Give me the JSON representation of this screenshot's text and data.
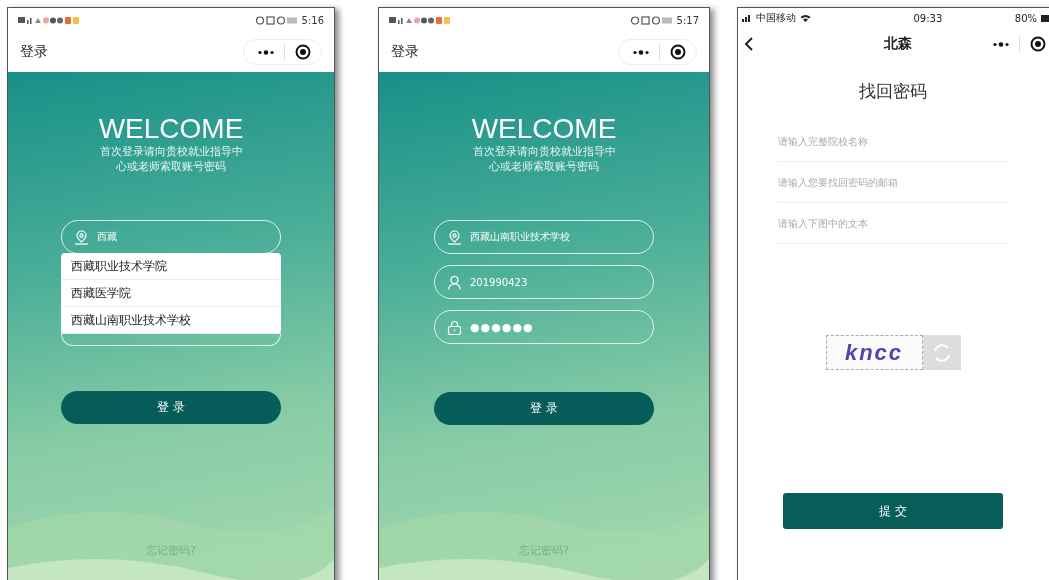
{
  "screens": [
    {
      "kind": "login",
      "status_bar": {
        "kind": "android",
        "time": "5:16"
      },
      "nav": {
        "title": "登录"
      },
      "heading": "WELCOME",
      "subtitle": "首次登录请向贵校就业指导中心或老师索取账号密码",
      "fields": [
        {
          "kind": "school",
          "value": "西藏"
        }
      ],
      "suggestions": [
        "西藏职业技术学院",
        "西藏医学院",
        "西藏山南职业技术学校"
      ],
      "login_button": "登 录",
      "forgot_link": "忘记密码?"
    },
    {
      "kind": "login",
      "status_bar": {
        "kind": "android",
        "time": "5:17"
      },
      "nav": {
        "title": "登录"
      },
      "heading": "WELCOME",
      "subtitle": "首次登录请向贵校就业指导中心或老师索取账号密码",
      "fields": [
        {
          "kind": "school",
          "value": "西藏山南职业技术学校"
        },
        {
          "kind": "user",
          "value": "201990423"
        },
        {
          "kind": "password",
          "value": "●●●●●●"
        }
      ],
      "login_button": "登 录",
      "forgot_link": "忘记密码?"
    },
    {
      "kind": "recover",
      "status_bar": {
        "kind": "ios",
        "carrier": "中国移动",
        "time": "09:33",
        "battery": "80%"
      },
      "nav": {
        "title": "北森",
        "back": true
      },
      "title": "找回密码",
      "inputs": [
        {
          "placeholder": "请输入完整院校名称"
        },
        {
          "placeholder": "请输入您要找回密码的邮箱"
        },
        {
          "placeholder": "请输入下图中的文本"
        }
      ],
      "captcha": "kncc",
      "submit_button": "提 交"
    }
  ]
}
